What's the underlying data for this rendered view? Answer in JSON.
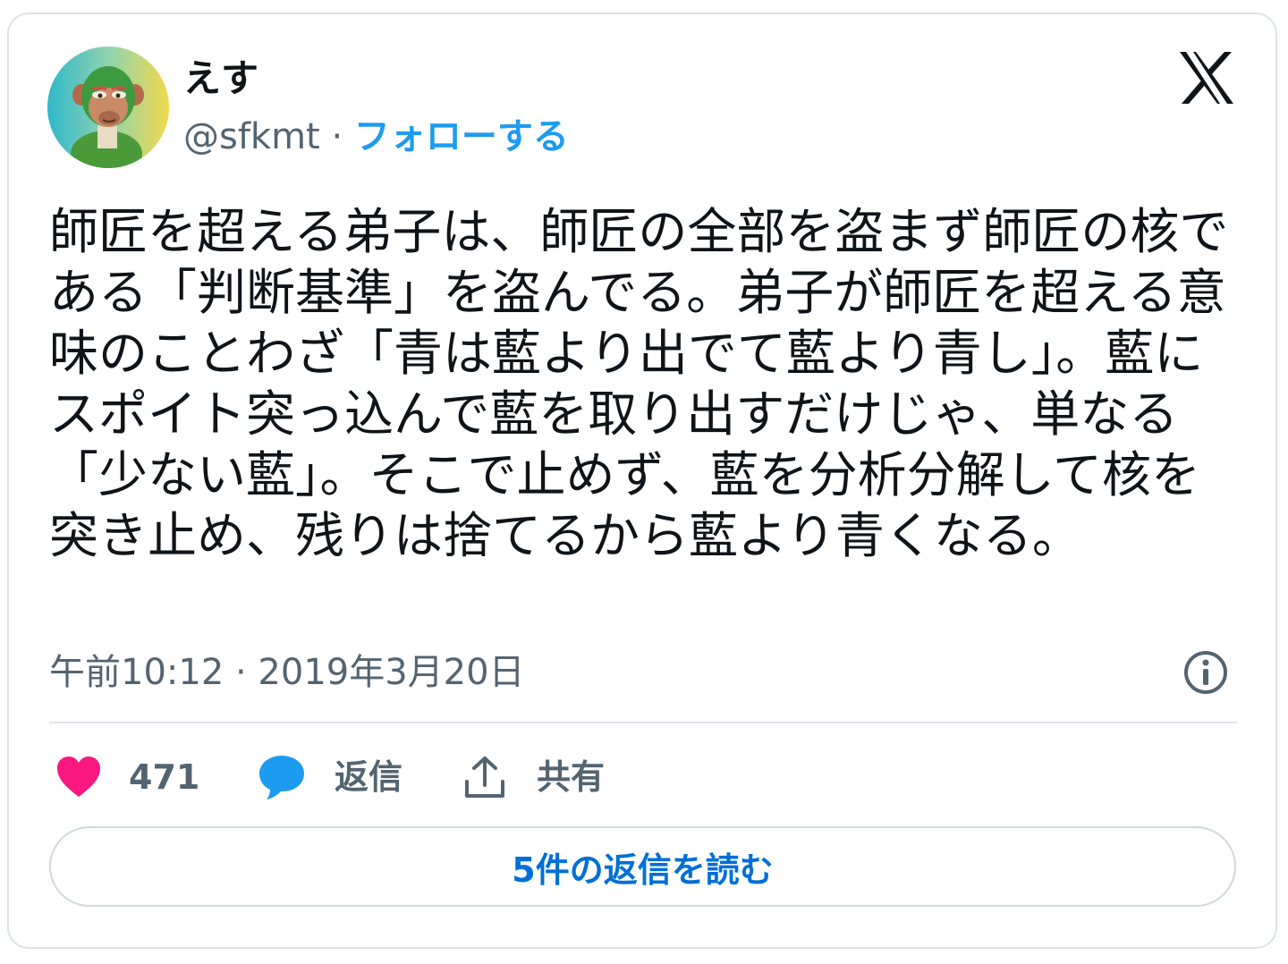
{
  "author": {
    "display_name": "えす",
    "handle": "@sfkmt",
    "separator": " · ",
    "follow_label": "フォローする",
    "avatar_icon": "monkey-avatar-icon"
  },
  "brand": {
    "logo_icon": "x-logo-icon"
  },
  "tweet": {
    "text": "師匠を超える弟子は、師匠の全部を盗まず師匠の核である「判断基準」を盗んでる。弟子が師匠を超える意味のことわざ「青は藍より出でて藍より青し」。藍にスポイト突っ込んで藍を取り出すだけじゃ、単なる「少ない藍」。そこで止めず、藍を分析分解して核を突き止め、残りは捨てるから藍より青くなる。",
    "timestamp": "午前10:12 · 2019年3月20日"
  },
  "actions": {
    "like_count": "471",
    "reply_label": "返信",
    "share_label": "共有"
  },
  "footer": {
    "read_replies_label": "5件の返信を読む"
  },
  "colors": {
    "accent": "#1d9bf0",
    "like": "#f91880",
    "text": "#0f1419",
    "secondary": "#536471"
  }
}
